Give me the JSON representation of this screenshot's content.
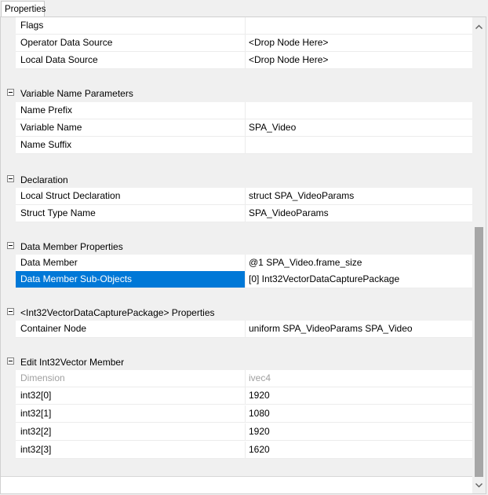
{
  "tab": {
    "label": "Properties"
  },
  "rows": [
    {
      "name": "Flags",
      "value": ""
    },
    {
      "name": "Operator Data Source",
      "value": "<Drop Node Here>"
    },
    {
      "name": "Local Data Source",
      "value": "<Drop Node Here>"
    }
  ],
  "categories": [
    {
      "label": "Variable Name Parameters",
      "rows": [
        {
          "name": "Name Prefix",
          "value": ""
        },
        {
          "name": "Variable Name",
          "value": "SPA_Video"
        },
        {
          "name": "Name Suffix",
          "value": ""
        }
      ]
    },
    {
      "label": "Declaration",
      "rows": [
        {
          "name": "Local Struct Declaration",
          "value": "struct SPA_VideoParams"
        },
        {
          "name": "Struct Type Name",
          "value": "SPA_VideoParams"
        }
      ]
    },
    {
      "label": "Data Member Properties",
      "rows": [
        {
          "name": "Data Member",
          "value": "@1 SPA_Video.frame_size"
        },
        {
          "name": "Data Member Sub-Objects",
          "value": "[0] Int32VectorDataCapturePackage",
          "selected": true
        }
      ]
    },
    {
      "label": "<Int32VectorDataCapturePackage> Properties",
      "rows": [
        {
          "name": "Container Node",
          "value": "uniform SPA_VideoParams SPA_Video"
        }
      ]
    },
    {
      "label": "Edit Int32Vector Member",
      "rows": [
        {
          "name": "Dimension",
          "value": "ivec4",
          "disabled": true
        },
        {
          "name": "int32[0]",
          "value": "1920"
        },
        {
          "name": "int32[1]",
          "value": "1080"
        },
        {
          "name": "int32[2]",
          "value": "1920"
        },
        {
          "name": "int32[3]",
          "value": "1620"
        }
      ]
    }
  ],
  "colors": {
    "selection": "#0078d7",
    "category_bg": "#f0f0f0",
    "scroll_thumb": "#a6a6a6",
    "disabled_text": "#a0a0a0"
  },
  "icons": {
    "collapse": "minus-box-icon",
    "scroll_up": "chevron-up-icon",
    "scroll_down": "chevron-down-icon"
  }
}
